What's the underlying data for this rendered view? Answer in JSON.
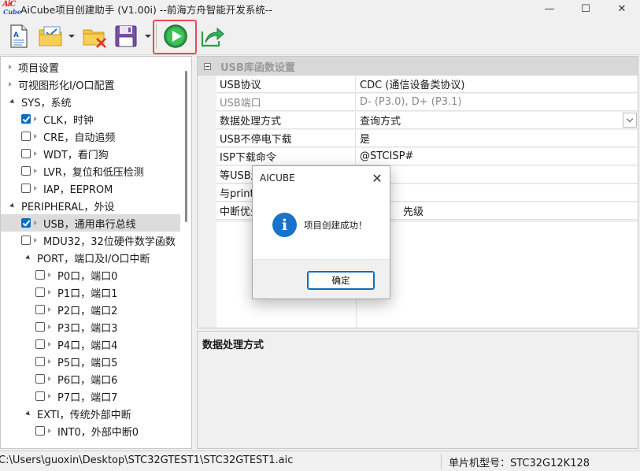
{
  "window": {
    "logo_top": "AiC",
    "logo_bottom": "Cube",
    "title": "AiCube项目创建助手 (V1.00i) --前海方舟智能开发系统--",
    "minimize_glyph": "—",
    "maximize_glyph": "☐",
    "close_glyph": "✕"
  },
  "toolbar": {
    "buttons": [
      "new-project-icon",
      "open-project-icon",
      "delete-project-icon",
      "save-project-icon",
      "run-generate-icon",
      "export-icon"
    ],
    "highlight_color": "#e84a5f"
  },
  "tree": {
    "items": [
      {
        "label": "项目设置"
      },
      {
        "label": "可视图形化I/O口配置"
      },
      {
        "label": "SYS，系统"
      },
      {
        "label": "CLK，时钟"
      },
      {
        "label": "CRE，自动追频"
      },
      {
        "label": "WDT，看门狗"
      },
      {
        "label": "LVR，复位和低压检测"
      },
      {
        "label": "IAP，EEPROM"
      },
      {
        "label": "PERIPHERAL，外设"
      },
      {
        "label": "USB，通用串行总线"
      },
      {
        "label": "MDU32，32位硬件数学函数"
      },
      {
        "label": "PORT，端口及I/O口中断"
      },
      {
        "label": "P0口，端口0"
      },
      {
        "label": "P1口，端口1"
      },
      {
        "label": "P2口，端口2"
      },
      {
        "label": "P3口，端口3"
      },
      {
        "label": "P4口，端口4"
      },
      {
        "label": "P5口，端口5"
      },
      {
        "label": "P6口，端口6"
      },
      {
        "label": "P7口，端口7"
      },
      {
        "label": "EXTI，传统外部中断"
      },
      {
        "label": "INT0，外部中断0"
      }
    ]
  },
  "props": {
    "category": "USB库函数设置",
    "rows": [
      {
        "name": "USB协议",
        "value": "CDC (通信设备类协议)"
      },
      {
        "name": "USB端口",
        "value": "D- (P3.0), D+ (P3.1)"
      },
      {
        "name": "数据处理方式",
        "value": "查询方式"
      },
      {
        "name": "USB不停电下载",
        "value": "是"
      },
      {
        "name": "ISP下载命令",
        "value": "@STCISP#"
      },
      {
        "name": "等USB连接",
        "value": ""
      },
      {
        "name": "与printf重定向",
        "value": ""
      },
      {
        "name": "中断优先级",
        "value": "先级"
      }
    ]
  },
  "description": {
    "title": "数据处理方式"
  },
  "status": {
    "path": "C:\\Users\\guoxin\\Desktop\\STC32GTEST1\\STC32GTEST1.aic",
    "chip": "单片机型号：STC32G12K128"
  },
  "dialog": {
    "title": "AICUBE",
    "close_glyph": "✕",
    "icon_glyph": "i",
    "message": "项目创建成功！",
    "ok_label": "确定"
  }
}
